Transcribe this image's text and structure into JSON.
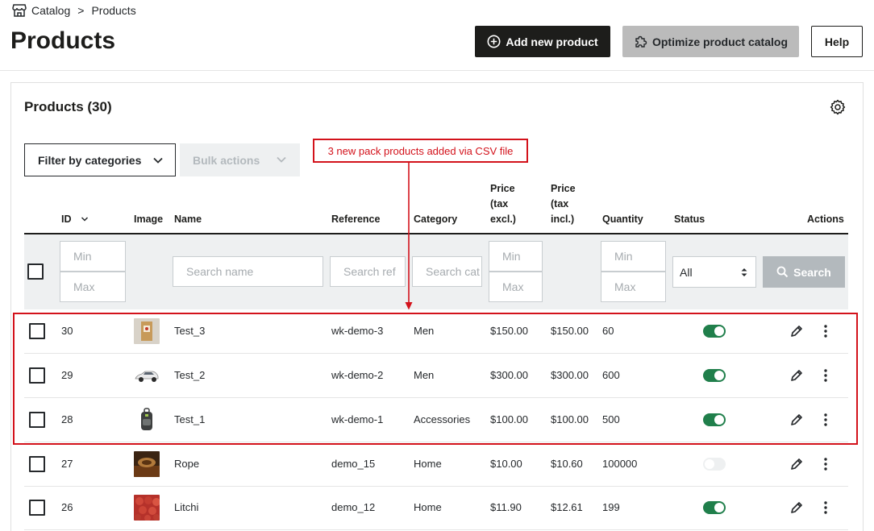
{
  "breadcrumb": {
    "root": "Catalog",
    "separator": ">",
    "current": "Products"
  },
  "header": {
    "title": "Products",
    "add_label": "Add new product",
    "optimize_label": "Optimize product catalog",
    "help_label": "Help"
  },
  "card": {
    "title": "Products (30)"
  },
  "filters": {
    "categories_label": "Filter by categories",
    "bulk_label": "Bulk actions",
    "min_placeholder": "Min",
    "max_placeholder": "Max",
    "name_placeholder": "Search name",
    "reference_placeholder": "Search ref",
    "category_placeholder": "Search cat",
    "status_value": "All",
    "search_label": "Search"
  },
  "annotation": {
    "text": "3 new pack products added via CSV file"
  },
  "columns": {
    "id": "ID",
    "image": "Image",
    "name": "Name",
    "reference": "Reference",
    "category": "Category",
    "price_excl": [
      "Price",
      "(tax",
      "excl.)"
    ],
    "price_incl": [
      "Price",
      "(tax",
      "incl.)"
    ],
    "quantity": "Quantity",
    "status": "Status",
    "actions": "Actions"
  },
  "rows": [
    {
      "id": "30",
      "image": "box-thumbnail",
      "name": "Test_3",
      "reference": "wk-demo-3",
      "category": "Men",
      "price_excl": "$150.00",
      "price_incl": "$150.00",
      "quantity": "60",
      "enabled": true
    },
    {
      "id": "29",
      "image": "car-thumbnail",
      "name": "Test_2",
      "reference": "wk-demo-2",
      "category": "Men",
      "price_excl": "$300.00",
      "price_incl": "$300.00",
      "quantity": "600",
      "enabled": true
    },
    {
      "id": "28",
      "image": "backpack-thumbnail",
      "name": "Test_1",
      "reference": "wk-demo-1",
      "category": "Accessories",
      "price_excl": "$100.00",
      "price_incl": "$100.00",
      "quantity": "500",
      "enabled": true
    },
    {
      "id": "27",
      "image": "rope-thumbnail",
      "name": "Rope",
      "reference": "demo_15",
      "category": "Home",
      "price_excl": "$10.00",
      "price_incl": "$10.60",
      "quantity": "100000",
      "enabled": false
    },
    {
      "id": "26",
      "image": "litchi-thumbnail",
      "name": "Litchi",
      "reference": "demo_12",
      "category": "Home",
      "price_excl": "$11.90",
      "price_incl": "$12.61",
      "quantity": "199",
      "enabled": true
    }
  ],
  "colors": {
    "accent_dark": "#1d1d1b",
    "toggle_on": "#207f4b",
    "annotation_red": "#d3121b",
    "search_button": "#b3b9bd"
  }
}
